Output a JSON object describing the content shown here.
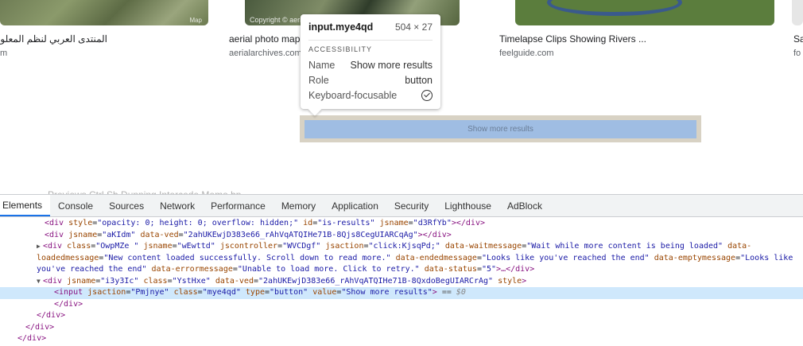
{
  "results": [
    {
      "title": "المنتدى العربي لنظم المعلو",
      "site": "m",
      "credit": "",
      "mapmark": "Map"
    },
    {
      "title": "aerial photo map",
      "site": "aerialarchives.com",
      "credit": "Copyright © aeri"
    },
    {
      "title": "Timelapse Clips Showing Rivers ...",
      "site": "feelguide.com"
    },
    {
      "title": "Sa",
      "site": "fo"
    }
  ],
  "show_more_label": "Show more results",
  "tooltip": {
    "tag": "input.mye4qd",
    "dims": "504 × 27",
    "section": "ACCESSIBILITY",
    "name_key": "Name",
    "name_val": "Show more results",
    "role_key": "Role",
    "role_val": "button",
    "focus_key": "Keyboard-focusable"
  },
  "ghost_text": "Previews  Ctrl Sh  Dunning  Intercede  Memo bp",
  "devtools": {
    "tabs": [
      "Elements",
      "Console",
      "Sources",
      "Network",
      "Performance",
      "Memory",
      "Application",
      "Security",
      "Lighthouse",
      "AdBlock"
    ],
    "active_tab": "Elements"
  },
  "dom": {
    "l1": {
      "t1": "<div ",
      "a1": "style",
      "v1": "\"opacity: 0; height: 0; overflow: hidden;\"",
      "a2": "id",
      "v2": "\"is-results\"",
      "a3": "jsname",
      "v3": "\"d3RfYb\"",
      "t2": "></div>"
    },
    "l2": {
      "t1": "<div ",
      "a1": "jsname",
      "v1": "\"aKIdm\"",
      "a2": "data-ved",
      "v2": "\"2ahUKEwjD383e66_rAhVqATQIHe71B-8Qjs8CegUIARCqAg\"",
      "t2": "></div>"
    },
    "l3": {
      "t1": "<div ",
      "a1": "class",
      "v1": "\"OwpMZe \"",
      "a2": "jsname",
      "v2": "\"wEwttd\"",
      "a3": "jscontroller",
      "v3": "\"WVCDgf\"",
      "a4": "jsaction",
      "v4": "\"click:KjsqPd;\"",
      "a5": "data-waitmessage",
      "v5": "\"Wait while more content is being loaded\"",
      "a6": "data-loadedmessage",
      "v6": "\"New content loaded successfully. Scroll down to read more.\"",
      "a7": "data-endedmessage",
      "v7": "\"Looks like you've reached the end\"",
      "a8": "data-emptymessage",
      "v8": "\"Looks like you've reached the end\"",
      "a9": "data-errormessage",
      "v9": "\"Unable to load more. Click to retry.\"",
      "a10": "data-status",
      "v10": "\"5\"",
      "t2": ">…</div>"
    },
    "l4": {
      "t1": "<div ",
      "a1": "jsname",
      "v1": "\"i3y3Ic\"",
      "a2": "class",
      "v2": "\"YstHxe\"",
      "a3": "data-ved",
      "v3": "\"2ahUKEwjD383e66_rAhVqATQIHe71B-8QxdoBegUIARCrAg\"",
      "a4": "style",
      "t2": ">"
    },
    "l5": {
      "t1": "<input ",
      "a1": "jsaction",
      "v1": "\"Pmjnye\"",
      "a2": "class",
      "v2": "\"mye4qd\"",
      "a3": "type",
      "v3": "\"button\"",
      "a4": "value",
      "v4": "\"Show more results\"",
      "t2": ">",
      "eq": " == ",
      "dollar": "$0"
    },
    "l6": "</div>",
    "l7": "</div>",
    "l8": "</div>",
    "l9": "</div>"
  }
}
